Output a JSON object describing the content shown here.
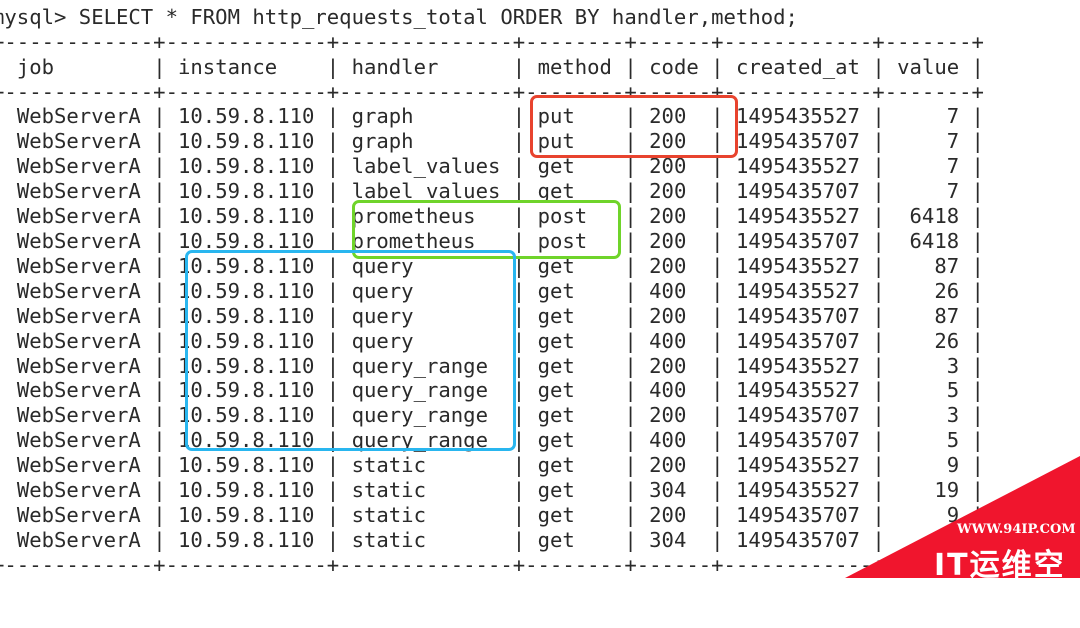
{
  "terminal": {
    "prompt": "mysql> ",
    "command": "SELECT * FROM http_requests_total ORDER BY handler,method;"
  },
  "table": {
    "columns": [
      "job",
      "instance",
      "handler",
      "method",
      "code",
      "created_at",
      "value"
    ],
    "rows": [
      [
        "WebServerA",
        "10.59.8.110",
        "graph",
        "put",
        "200",
        "1495435527",
        "7"
      ],
      [
        "WebServerA",
        "10.59.8.110",
        "graph",
        "put",
        "200",
        "1495435707",
        "7"
      ],
      [
        "WebServerA",
        "10.59.8.110",
        "label_values",
        "get",
        "200",
        "1495435527",
        "7"
      ],
      [
        "WebServerA",
        "10.59.8.110",
        "label_values",
        "get",
        "200",
        "1495435707",
        "7"
      ],
      [
        "WebServerA",
        "10.59.8.110",
        "prometheus",
        "post",
        "200",
        "1495435527",
        "6418"
      ],
      [
        "WebServerA",
        "10.59.8.110",
        "prometheus",
        "post",
        "200",
        "1495435707",
        "6418"
      ],
      [
        "WebServerA",
        "10.59.8.110",
        "query",
        "get",
        "200",
        "1495435527",
        "87"
      ],
      [
        "WebServerA",
        "10.59.8.110",
        "query",
        "get",
        "400",
        "1495435527",
        "26"
      ],
      [
        "WebServerA",
        "10.59.8.110",
        "query",
        "get",
        "200",
        "1495435707",
        "87"
      ],
      [
        "WebServerA",
        "10.59.8.110",
        "query",
        "get",
        "400",
        "1495435707",
        "26"
      ],
      [
        "WebServerA",
        "10.59.8.110",
        "query_range",
        "get",
        "200",
        "1495435527",
        "3"
      ],
      [
        "WebServerA",
        "10.59.8.110",
        "query_range",
        "get",
        "400",
        "1495435527",
        "5"
      ],
      [
        "WebServerA",
        "10.59.8.110",
        "query_range",
        "get",
        "200",
        "1495435707",
        "3"
      ],
      [
        "WebServerA",
        "10.59.8.110",
        "query_range",
        "get",
        "400",
        "1495435707",
        "5"
      ],
      [
        "WebServerA",
        "10.59.8.110",
        "static",
        "get",
        "200",
        "1495435527",
        "9"
      ],
      [
        "WebServerA",
        "10.59.8.110",
        "static",
        "get",
        "304",
        "1495435527",
        "19"
      ],
      [
        "WebServerA",
        "10.59.8.110",
        "static",
        "get",
        "200",
        "1495435707",
        "9"
      ],
      [
        "WebServerA",
        "10.59.8.110",
        "static",
        "get",
        "304",
        "1495435707",
        ""
      ]
    ]
  },
  "highlights": {
    "red": "#e8432e",
    "green": "#6fd42a",
    "blue": "#29b6ef"
  },
  "watermark": {
    "url": "WWW.94IP.COM",
    "name": "IT运维空间",
    "color": "#f0152d"
  }
}
